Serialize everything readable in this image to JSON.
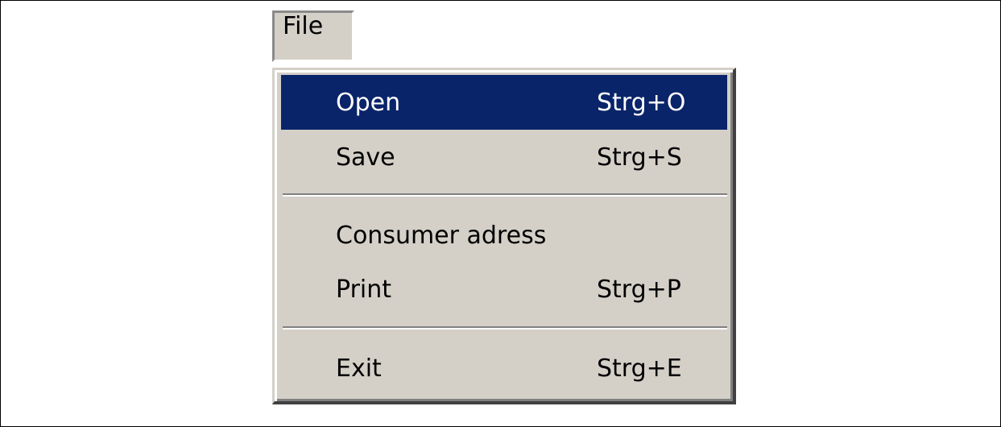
{
  "menubar": {
    "file_label": "File"
  },
  "menu": {
    "items": [
      {
        "label": "Open",
        "shortcut": "Strg+O",
        "highlighted": true
      },
      {
        "label": "Save",
        "shortcut": "Strg+S"
      },
      {
        "label": "Consumer adress",
        "shortcut": ""
      },
      {
        "label": "Print",
        "shortcut": "Strg+P"
      },
      {
        "label": "Exit",
        "shortcut": "Strg+E"
      }
    ]
  },
  "colors": {
    "menu_background": "#d4d0c8",
    "highlight_background": "#0a246a",
    "highlight_text": "#ffffff"
  }
}
